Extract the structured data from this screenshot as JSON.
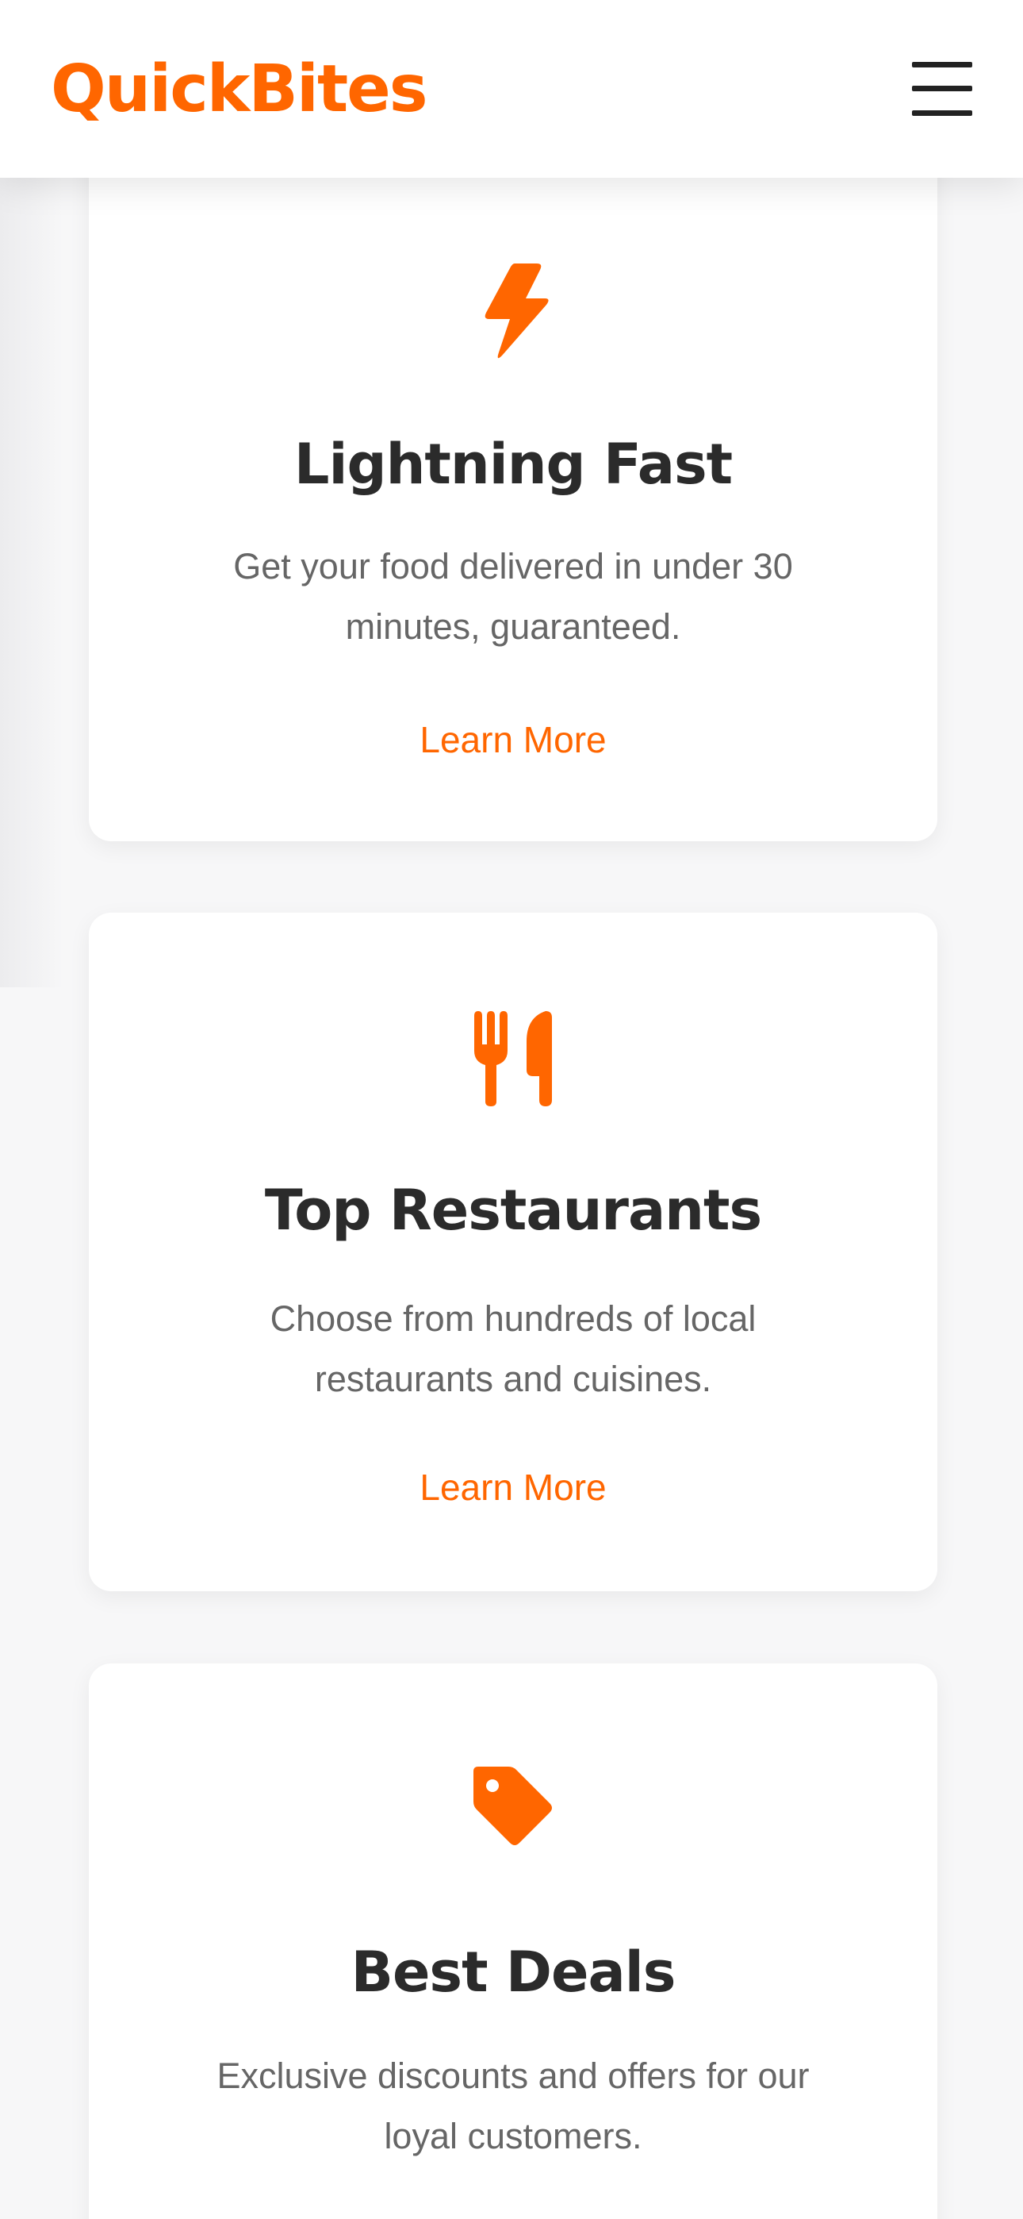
{
  "header": {
    "logo": "QuickBites",
    "menu_icon": "hamburger-menu-icon"
  },
  "colors": {
    "accent": "#ff6600",
    "heading": "#2b2b2b",
    "body_text": "#666666",
    "card_bg": "#ffffff",
    "page_bg": "#f7f7f8"
  },
  "features": [
    {
      "icon": "lightning-bolt-icon",
      "title": "Lightning Fast",
      "description_line1": "Get your food delivered in under 30",
      "description_line2": "minutes, guaranteed.",
      "link": "Learn More"
    },
    {
      "icon": "fork-knife-icon",
      "title": "Top Restaurants",
      "description_line1": "Choose from hundreds of local",
      "description_line2": "restaurants and cuisines.",
      "link": "Learn More"
    },
    {
      "icon": "price-tag-icon",
      "title": "Best Deals",
      "description_line1": "Exclusive discounts and offers for our",
      "description_line2": "loyal customers."
    }
  ]
}
